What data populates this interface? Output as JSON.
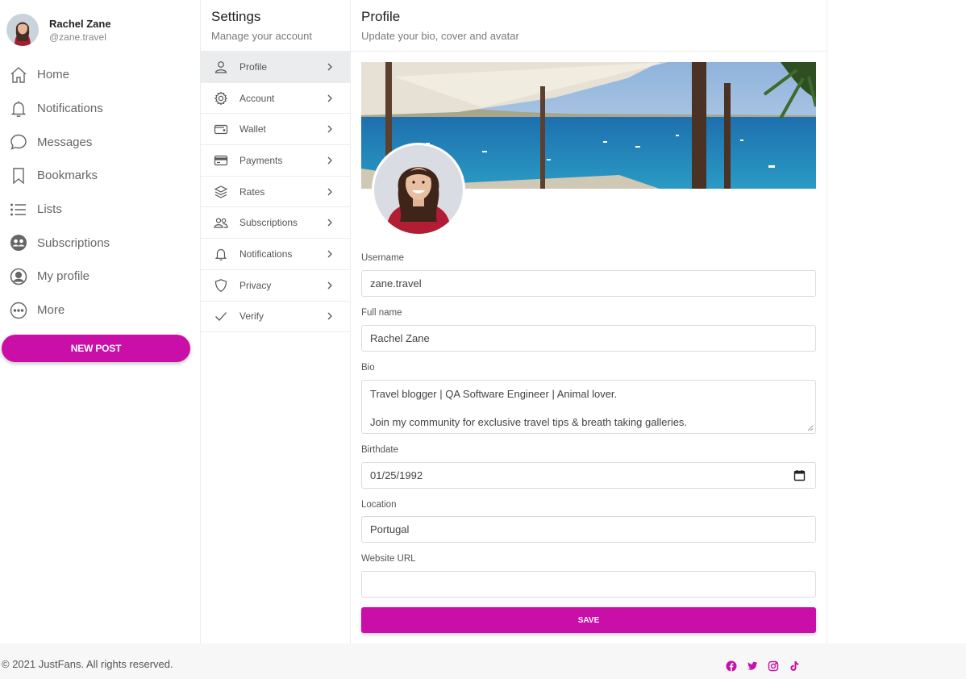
{
  "user": {
    "name": "Rachel Zane",
    "handle": "@zane.travel"
  },
  "nav": {
    "items": [
      {
        "label": "Home",
        "icon": "home-icon"
      },
      {
        "label": "Notifications",
        "icon": "bell-icon"
      },
      {
        "label": "Messages",
        "icon": "chat-bubble-icon"
      },
      {
        "label": "Bookmarks",
        "icon": "bookmark-icon"
      },
      {
        "label": "Lists",
        "icon": "list-icon"
      },
      {
        "label": "Subscriptions",
        "icon": "people-circle-icon"
      },
      {
        "label": "My profile",
        "icon": "user-circle-icon"
      },
      {
        "label": "More",
        "icon": "ellipsis-circle-icon"
      }
    ],
    "new_post_label": "NEW POST"
  },
  "settings": {
    "title": "Settings",
    "subtitle": "Manage your account",
    "items": [
      {
        "label": "Profile",
        "icon": "person-icon",
        "active": true
      },
      {
        "label": "Account",
        "icon": "gear-icon"
      },
      {
        "label": "Wallet",
        "icon": "wallet-icon"
      },
      {
        "label": "Payments",
        "icon": "credit-card-icon"
      },
      {
        "label": "Rates",
        "icon": "layers-icon"
      },
      {
        "label": "Subscriptions",
        "icon": "people-icon"
      },
      {
        "label": "Notifications",
        "icon": "bell-icon"
      },
      {
        "label": "Privacy",
        "icon": "shield-icon"
      },
      {
        "label": "Verify",
        "icon": "check-icon"
      }
    ]
  },
  "profile": {
    "title": "Profile",
    "subtitle": "Update your bio, cover and avatar",
    "username_label": "Username",
    "username_value": "zane.travel",
    "fullname_label": "Full name",
    "fullname_value": "Rachel Zane",
    "bio_label": "Bio",
    "bio_line1": "Travel blogger | QA Software Engineer | Animal lover.",
    "bio_line2": "Join my community for exclusive travel tips & breath taking galleries.",
    "birthdate_label": "Birthdate",
    "birthdate_value": "01/25/1992",
    "location_label": "Location",
    "location_value": "Portugal",
    "website_label": "Website URL",
    "website_value": "",
    "save_label": "SAVE"
  },
  "footer": {
    "copyright": "© 2021 JustFans. All rights reserved.",
    "socials": [
      "facebook-icon",
      "twitter-icon",
      "instagram-icon",
      "tiktok-icon"
    ]
  },
  "colors": {
    "accent": "#c90fa7",
    "border": "#ececec",
    "active_bg": "#ebeced",
    "footer_bg": "#f7f7f7"
  }
}
